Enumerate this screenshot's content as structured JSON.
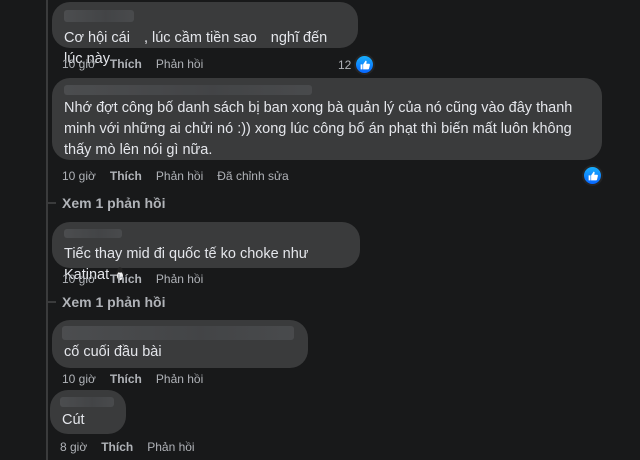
{
  "comments": [
    {
      "text_parts": [
        "Cơ hội cái",
        ", lúc cầm tiền sao",
        "nghĩ đến lúc này"
      ],
      "time": "10 giờ",
      "like": "Thích",
      "reply": "Phản hồi",
      "reaction_count": "12"
    },
    {
      "text": "Nhớ đợt công bố danh sách bị ban xong bà quản lý của nó cũng vào đây thanh minh với những ai chửi nó :)) xong lúc công bố án phạt thì biến mất luôn không thấy mò lên nói gì nữa.",
      "time": "10 giờ",
      "like": "Thích",
      "reply": "Phản hồi",
      "edited": "Đã chỉnh sửa",
      "view_replies": "Xem 1 phản hồi"
    },
    {
      "text": "Tiếc thay mid đi quốc tế ko choke như Katinat",
      "emoji": "penguin-emoji",
      "time": "10 giờ",
      "like": "Thích",
      "reply": "Phản hồi",
      "view_replies": "Xem 1 phản hồi"
    },
    {
      "text": "cố cuối đầu bài",
      "time": "10 giờ",
      "like": "Thích",
      "reply": "Phản hồi"
    },
    {
      "text": "Cút",
      "time": "8 giờ",
      "like": "Thích",
      "reply": "Phản hồi"
    }
  ],
  "icons": {
    "reaction": "like-icon"
  },
  "colors": {
    "background": "#18191a",
    "bubble": "#3a3b3c",
    "like_blue": "#0866ff"
  }
}
